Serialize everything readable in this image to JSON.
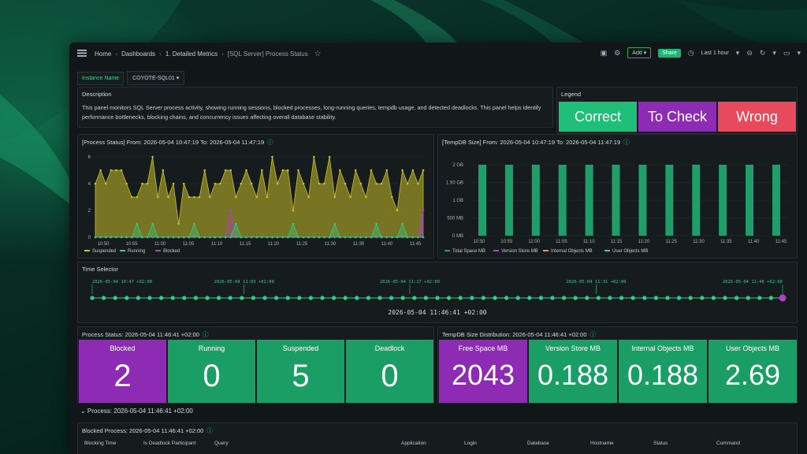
{
  "breadcrumb": {
    "home": "Home",
    "dashboards": "Dashboards",
    "folder": "1. Detailed Metrics",
    "current": "[SQL Server] Process Status"
  },
  "toolbar": {
    "add": "Add ▾",
    "share": "Share",
    "time_range": "Last 1 hour"
  },
  "variables": {
    "label": "Instance Name",
    "value": "COYOTE-SQL01 ▾"
  },
  "description": {
    "title": "Description",
    "text": "This panel monitors SQL Server process activity, showing running sessions, blocked processes, long-running queries, tempdb usage, and detected deadlocks. This panel helps identify performance bottlenecks, blocking chains, and concurrency issues affecting overall database stability."
  },
  "legend": {
    "title": "Legend",
    "correct": "Correct",
    "check": "To Check",
    "wrong": "Wrong",
    "correct_color": "#1fbf7a",
    "check_color": "#8e2bb5",
    "wrong_color": "#e64a5c"
  },
  "process_chart": {
    "title": "[Process Status] From: 2026-05-04 10:47:19 To: 2026-05-04 11:47:19",
    "legend": [
      "Running",
      "Suspended",
      "Blocked"
    ]
  },
  "tempdb_chart": {
    "title": "[TempDB Size] From: 2026-05-04 10:47:19 To: 2026-05-04 11:47:19",
    "legend": [
      "Total Space MB",
      "Version Store MB",
      "Internal Objects MB",
      "User Objects MB"
    ]
  },
  "time_selector": {
    "title": "Time Selector",
    "ticks": [
      "2026-05-04 10:47 +02:00",
      "2026-05-04 11:03 +02:00",
      "2026-05-04 11:17 +02:00",
      "2026-05-04 11:31 +02:00",
      "2026-05-04 11:46 +02:00"
    ],
    "selected": "2026-05-04 11:46:41 +02:00",
    "selected_fraction": 1.0
  },
  "process_status": {
    "title": "Process Status: 2026-05-04 11:46:41 +02:00",
    "stats": [
      {
        "label": "Blocked",
        "value": "2"
      },
      {
        "label": "Running",
        "value": "0"
      },
      {
        "label": "Suspended",
        "value": "5"
      },
      {
        "label": "Deadlock",
        "value": "0"
      }
    ]
  },
  "tempdb_dist": {
    "title": "TempDB Size Distribution: 2026-05-04 11:46:41 +02:00",
    "stats": [
      {
        "label": "Free Space MB",
        "value": "2043"
      },
      {
        "label": "Version Store MB",
        "value": "0.188"
      },
      {
        "label": "Internal Objects MB",
        "value": "0.188"
      },
      {
        "label": "User Objects MB",
        "value": "2.69"
      }
    ]
  },
  "section": {
    "title": "⌄ Process: 2026-05-04 11:46:41 +02:00"
  },
  "blocked": {
    "title": "Blocked Process: 2026-05-04 11:46:41 +02:00",
    "columns": [
      "Blocking Time",
      "Is Deadlock Participant",
      "Query",
      "Application",
      "Login",
      "Database",
      "Hostname",
      "Status",
      "Command"
    ]
  },
  "chart_data": [
    {
      "type": "area",
      "title": "[Process Status] From: 2026-05-04 10:47:19 To: 2026-05-04 11:47:19",
      "x": [
        "10:50",
        "10:55",
        "11:00",
        "11:05",
        "11:10",
        "11:15",
        "11:20",
        "11:25",
        "11:30",
        "11:35",
        "11:40",
        "11:45"
      ],
      "ylim": [
        0,
        6
      ],
      "yticks": [
        0,
        2,
        4,
        6
      ],
      "series": [
        {
          "name": "Suspended",
          "color": "#c9c02a",
          "values": [
            4,
            5,
            4,
            5,
            5,
            5,
            4,
            3,
            3,
            4,
            4,
            6,
            3,
            5,
            3,
            4,
            1,
            4,
            3,
            3,
            3,
            5,
            3,
            4,
            4,
            5,
            5,
            3,
            4,
            5,
            4,
            3,
            5,
            3,
            6,
            4,
            5,
            5,
            2,
            5,
            4,
            3,
            6,
            4,
            4,
            6,
            3,
            5,
            4,
            3,
            5,
            4,
            3,
            5,
            4,
            4,
            5,
            3,
            2,
            5,
            4,
            5,
            4,
            5
          ]
        },
        {
          "name": "Running",
          "color": "#2fcf8a",
          "values": [
            0,
            0,
            0,
            0,
            0,
            0,
            0,
            0,
            1,
            0,
            0,
            1,
            0,
            0,
            0,
            0,
            0,
            0,
            0,
            1,
            0,
            0,
            0,
            0,
            0,
            0,
            0,
            1,
            0,
            0,
            0,
            0,
            0,
            0,
            0,
            0,
            0,
            0,
            1,
            0,
            0,
            0,
            0,
            0,
            0,
            0,
            1,
            0,
            0,
            0,
            0,
            0,
            0,
            0,
            1,
            0,
            0,
            0,
            0,
            1,
            0,
            0,
            0,
            0
          ]
        },
        {
          "name": "Blocked",
          "color": "#b040c8",
          "values": [
            0,
            0,
            0,
            0,
            0,
            0,
            0,
            0,
            0,
            0,
            0,
            0,
            0,
            0,
            0,
            0,
            0,
            0,
            0,
            0,
            0,
            0,
            0,
            0,
            0,
            0,
            2,
            0,
            0,
            0,
            0,
            0,
            0,
            0,
            0,
            0,
            0,
            0,
            0,
            0,
            0,
            0,
            0,
            0,
            0,
            0,
            0,
            0,
            0,
            0,
            0,
            0,
            0,
            0,
            0,
            0,
            0,
            0,
            0,
            0,
            0,
            0,
            0,
            2
          ]
        }
      ]
    },
    {
      "type": "bar",
      "title": "[TempDB Size] From: 2026-05-04 10:47:19 To: 2026-05-04 11:47:19",
      "x": [
        "10:50",
        "10:55",
        "11:00",
        "11:05",
        "11:10",
        "11:15",
        "11:20",
        "11:25",
        "11:30",
        "11:35",
        "11:40",
        "11:45"
      ],
      "yticks": [
        "0 MB",
        "500 MB",
        "1 GB",
        "1.50 GB",
        "2 GB"
      ],
      "ylim": [
        0,
        2048
      ],
      "series": [
        {
          "name": "Total Space MB",
          "color": "#1f9e6a",
          "values": [
            2048,
            2048,
            2048,
            2048,
            2048,
            2048,
            2048,
            2048,
            2048,
            2048,
            2048,
            2048
          ]
        }
      ]
    }
  ]
}
